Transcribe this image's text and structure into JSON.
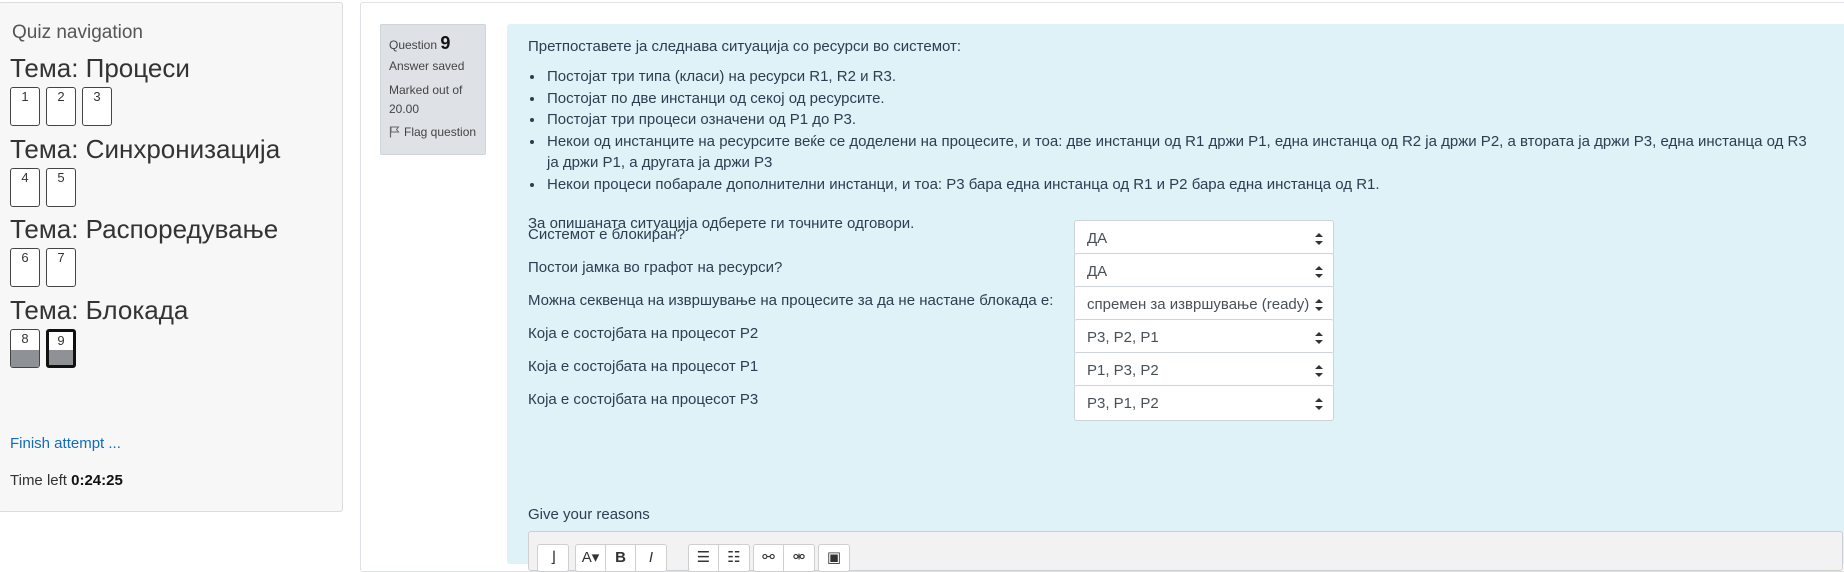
{
  "nav": {
    "title": "Quiz navigation",
    "sections": [
      {
        "heading": "Тема: Процеси",
        "buttons": [
          {
            "num": "1",
            "state": "plain"
          },
          {
            "num": "2",
            "state": "plain"
          },
          {
            "num": "3",
            "state": "plain"
          }
        ]
      },
      {
        "heading": "Тема: Синхронизација",
        "buttons": [
          {
            "num": "4",
            "state": "plain"
          },
          {
            "num": "5",
            "state": "plain"
          }
        ]
      },
      {
        "heading": "Тема: Распоредување",
        "buttons": [
          {
            "num": "6",
            "state": "plain"
          },
          {
            "num": "7",
            "state": "plain"
          }
        ]
      },
      {
        "heading": "Тема: Блокада",
        "buttons": [
          {
            "num": "8",
            "state": "answered"
          },
          {
            "num": "9",
            "state": "answered-current"
          }
        ]
      }
    ],
    "finish_link": "Finish attempt ...",
    "time_left_label": "Time left",
    "time_left_value": "0:24:25"
  },
  "question_info": {
    "label": "Question",
    "number": "9",
    "state": "Answer saved",
    "grade": "Marked out of 20.00",
    "flag": "Flag question"
  },
  "question": {
    "intro": "Претпоставете ја следнава ситуација со ресурси во системот:",
    "bullets": [
      "Постојат три типа (класи) на ресурси R1, R2 и R3.",
      "Постојат по две инстанци од секој од ресурсите.",
      "Постојат три процеси означени од P1 до P3.",
      "Некои од инстанците на ресурсите веќе се доделени на процесите, и тоа: две инстанци од R1 држи P1, една инстанца од R2 ја држи P2, а втората ја држи P3, една инстанца од R3 ја држи P1, а другата ја држи P3",
      "Некои процеси побарале дополнителни инстанци, и тоа: P3 бара една инстанца од R1 и P2 бара една инстанца од R1."
    ],
    "prompt": "За опишаната ситуација одберете ги точните одговори.",
    "rows": [
      {
        "label": "Системот е блокиран?",
        "value": "ДА"
      },
      {
        "label": "Постои јамка во графот на ресурси?",
        "value": "ДА"
      },
      {
        "label": "Можна секвенца на извршување на процесите за да не настане блокада е:",
        "value": "спремен за извршување (ready)"
      },
      {
        "label": "Која е состојбата на процесот P2",
        "value": "P3, P2, P1"
      },
      {
        "label": "Која е состојбата на процесот P1",
        "value": "P1, P3, P2"
      },
      {
        "label": "Која е состојбата на процесот P3",
        "value": "P3, P1, P2"
      }
    ],
    "reasons_label": "Give your reasons"
  },
  "editor_toolbar": {
    "groups": [
      [
        "collapse-icon"
      ],
      [
        "font-style-icon",
        "bold-icon",
        "italic-icon"
      ],
      [
        "unordered-list-icon",
        "ordered-list-icon"
      ],
      [
        "link-icon",
        "unlink-icon"
      ],
      [
        "image-icon"
      ]
    ],
    "glyphs": {
      "collapse-icon": "⌋",
      "font-style-icon": "A▾",
      "bold-icon": "B",
      "italic-icon": "I",
      "unordered-list-icon": "☰",
      "ordered-list-icon": "☷",
      "link-icon": "⚯",
      "unlink-icon": "⚮",
      "image-icon": "▣"
    }
  },
  "colors": {
    "link": "#0f6cbf",
    "question_bg": "#def2f8",
    "info_bg": "#dee2e6"
  }
}
